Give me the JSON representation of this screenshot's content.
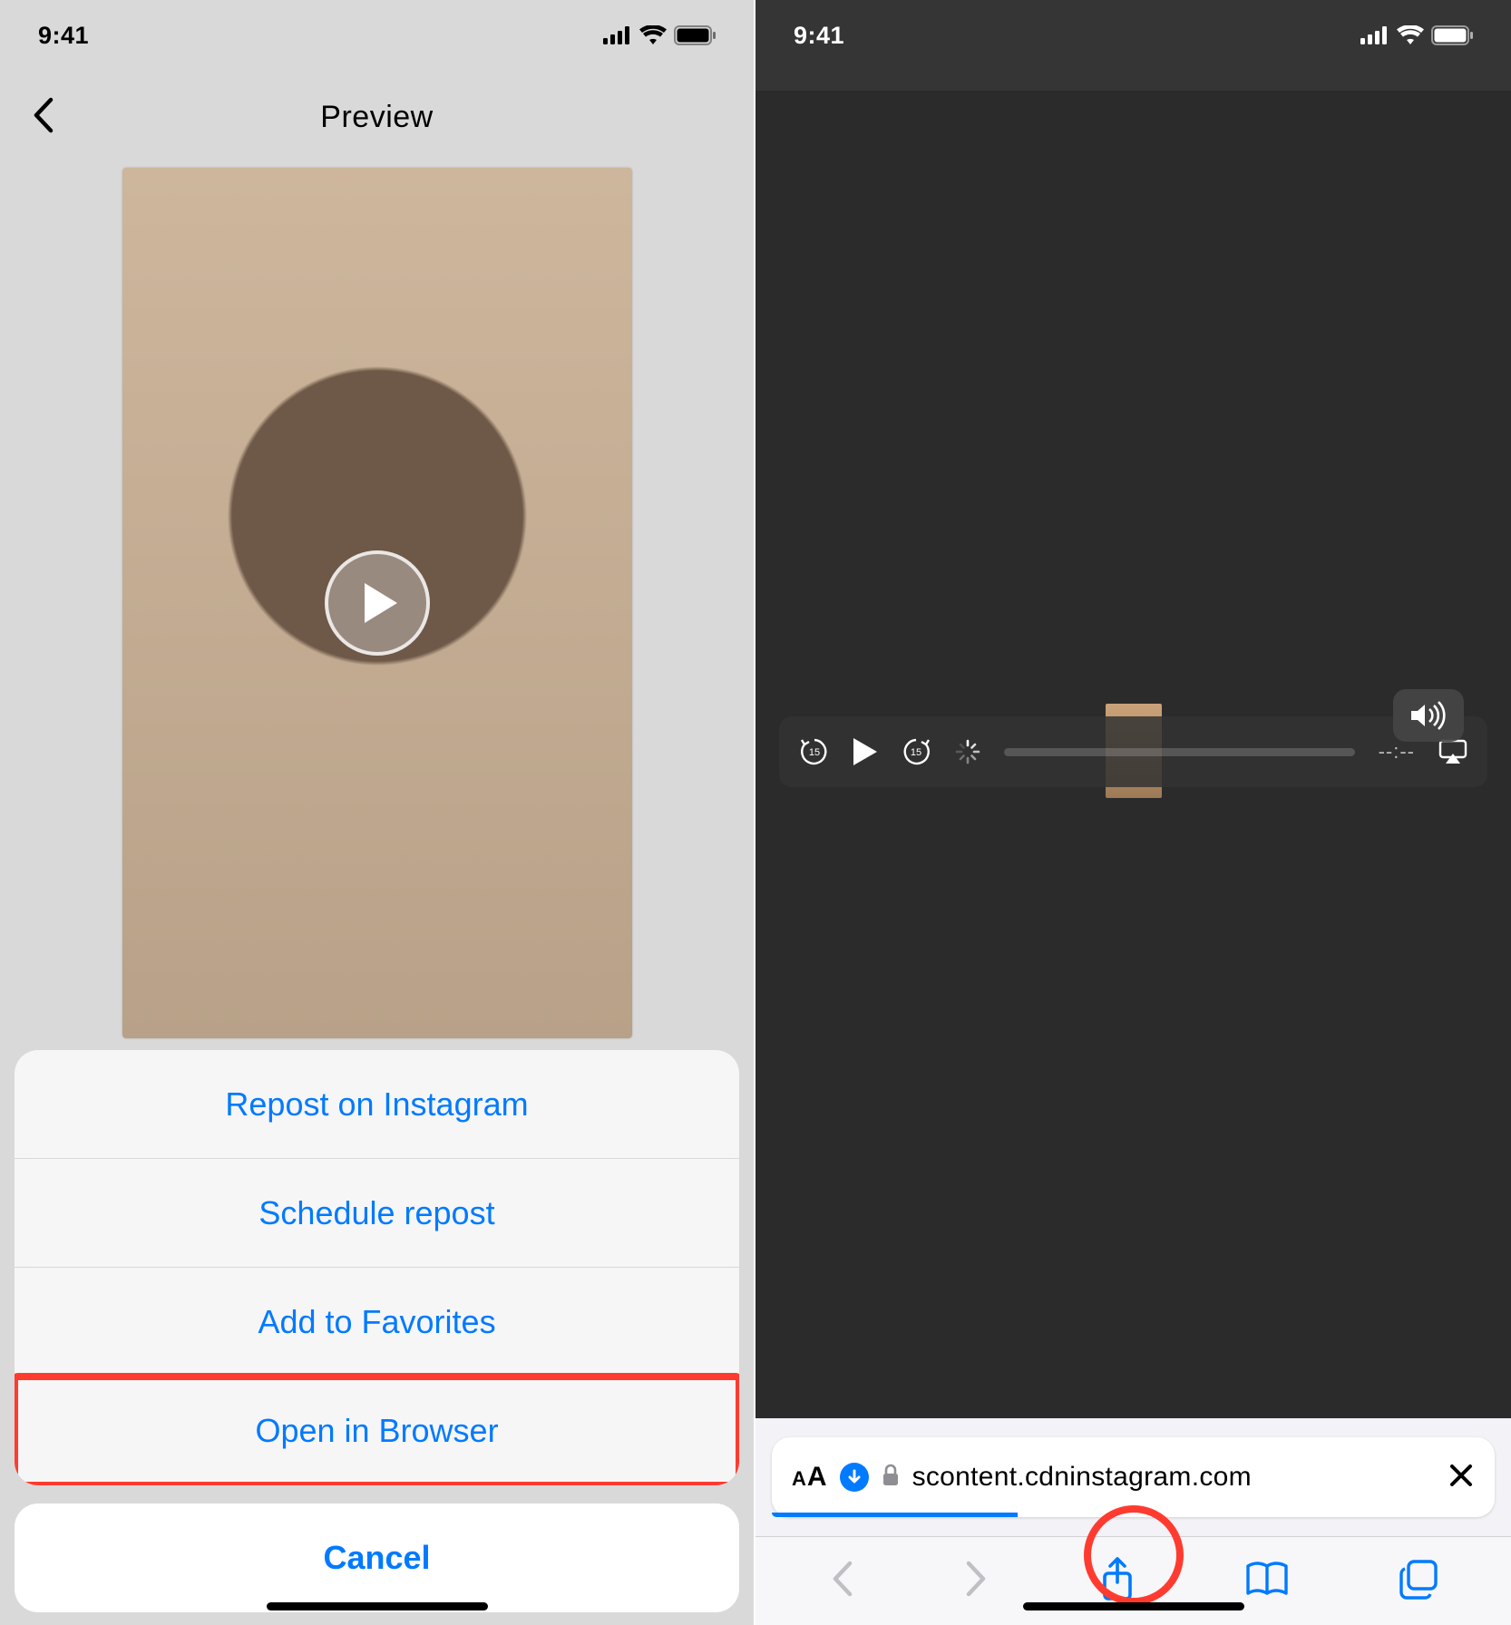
{
  "left": {
    "status": {
      "time": "9:41"
    },
    "nav_title": "Preview",
    "sheet": {
      "items": [
        {
          "id": "repost",
          "label": "Repost on Instagram"
        },
        {
          "id": "schedule",
          "label": "Schedule repost"
        },
        {
          "id": "fav",
          "label": "Add to Favorites"
        },
        {
          "id": "browser",
          "label": "Open in Browser",
          "highlighted": true
        }
      ],
      "cancel": "Cancel"
    }
  },
  "right": {
    "status": {
      "time": "9:41"
    },
    "video": {
      "time_display": "--:--"
    },
    "address_bar": {
      "aa_small": "A",
      "aa_big": "A",
      "url": "scontent.cdninstagram.com"
    },
    "toolbar": {
      "back_enabled": false,
      "forward_enabled": false,
      "share_highlighted": true
    }
  }
}
